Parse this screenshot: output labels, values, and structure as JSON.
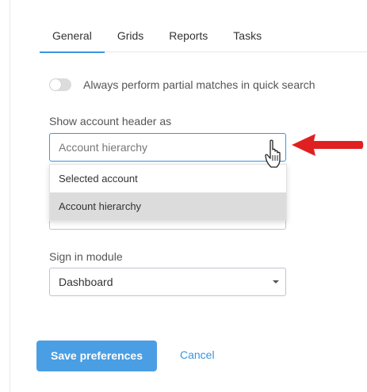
{
  "tabs": [
    {
      "label": "General",
      "active": true
    },
    {
      "label": "Grids",
      "active": false
    },
    {
      "label": "Reports",
      "active": false
    },
    {
      "label": "Tasks",
      "active": false
    }
  ],
  "quick_search": {
    "label": "Always perform partial matches in quick search",
    "enabled": false
  },
  "account_header": {
    "label": "Show account header as",
    "value": "Account hierarchy",
    "options": [
      "Selected account",
      "Account hierarchy"
    ],
    "highlighted_option": "Account hierarchy"
  },
  "sign_in_module": {
    "label": "Sign in module",
    "value": "Dashboard"
  },
  "actions": {
    "save_label": "Save preferences",
    "cancel_label": "Cancel"
  },
  "colors": {
    "accent": "#3a95e0",
    "button": "#4a9ee3",
    "annotation_arrow": "#e02020"
  },
  "icons": {
    "pointer": "hand-pointer-icon",
    "annotation": "red-arrow-icon"
  }
}
